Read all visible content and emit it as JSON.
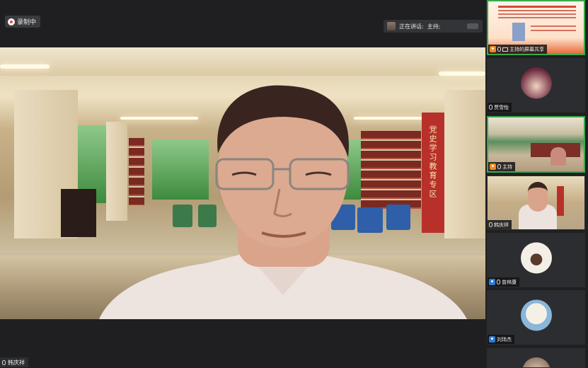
{
  "recording": {
    "label": "录制中"
  },
  "speaking": {
    "prefix": "正在讲话:",
    "name": "主持;"
  },
  "main_speaker": {
    "name": "韩庆祥"
  },
  "banner_text": "党史学习教育专区",
  "participants": [
    {
      "name": "主持的屏幕共享",
      "type": "screen-share",
      "role": "host"
    },
    {
      "name": "贾雪怡",
      "type": "avatar"
    },
    {
      "name": "主持",
      "type": "video",
      "role": "host"
    },
    {
      "name": "韩庆祥",
      "type": "video"
    },
    {
      "name": "曾林康",
      "type": "avatar",
      "role": "member"
    },
    {
      "name": "刘玮杰",
      "type": "avatar",
      "role": "member"
    }
  ],
  "colors": {
    "active_border": "#3ba94b",
    "host_icon": "#f08a24",
    "member_icon": "#2f7bd8",
    "record_dot": "#e84a3c"
  }
}
